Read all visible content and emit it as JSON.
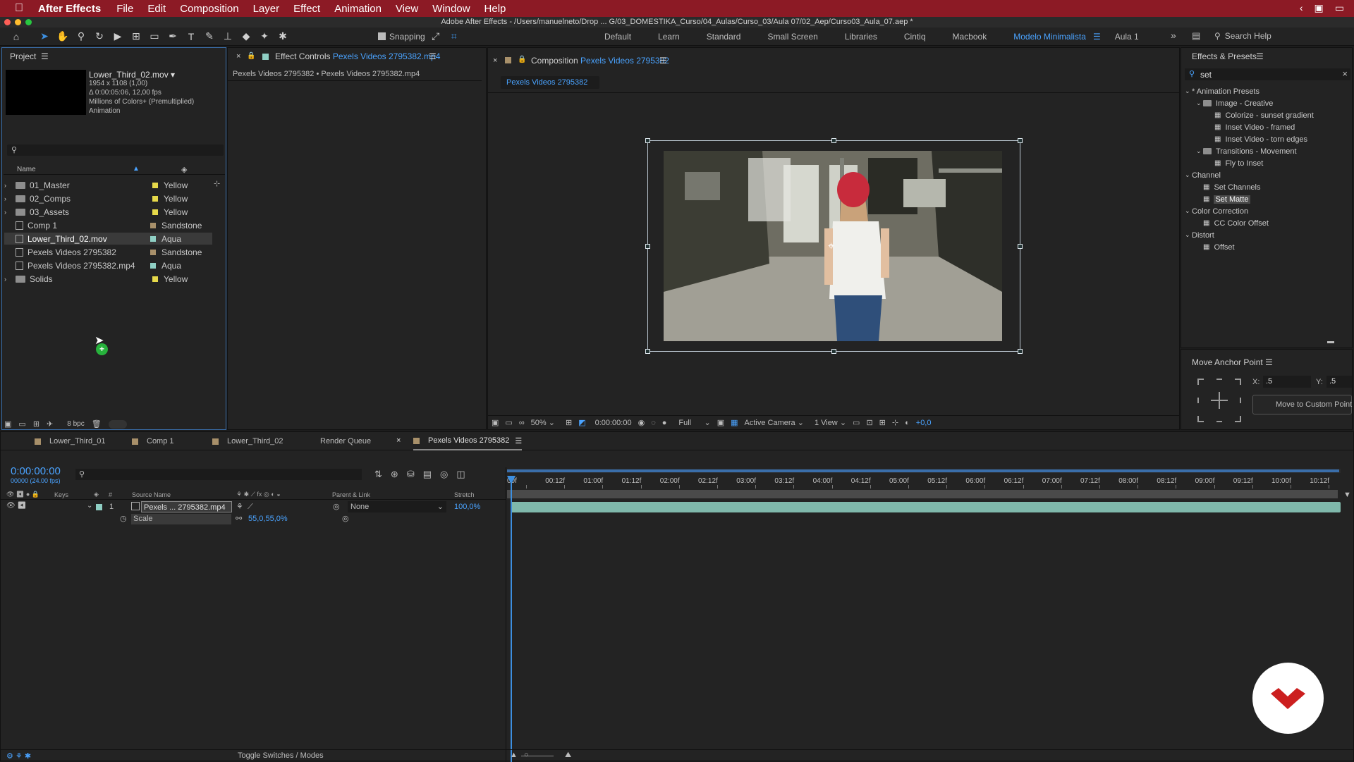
{
  "menubar": {
    "app_name": "After Effects",
    "items": [
      "File",
      "Edit",
      "Composition",
      "Layer",
      "Effect",
      "Animation",
      "View",
      "Window",
      "Help"
    ]
  },
  "window_title": "Adobe After Effects - /Users/manuelneto/Drop ... G/03_DOMESTIKA_Curso/04_Aulas/Curso_03/Aula 07/02_Aep/Curso03_Aula_07.aep *",
  "toolbar": {
    "snapping_label": "Snapping",
    "workspaces": [
      "Default",
      "Learn",
      "Standard",
      "Small Screen",
      "Libraries",
      "Cintiq",
      "Macbook",
      "Modelo Minimalista",
      "Aula 1"
    ],
    "active_workspace": "Modelo Minimalista",
    "search_help": "Search Help"
  },
  "project": {
    "tab_label": "Project",
    "selected_name": "Lower_Third_02.mov ▾",
    "info_lines": [
      "1954 x 1108 (1,00)",
      "Δ 0:00:05:06, 12,00 fps",
      "Millions of Colors+ (Premultiplied)",
      "Animation"
    ],
    "col_name": "Name",
    "items": [
      {
        "name": "01_Master",
        "label": "Yellow",
        "color": "#e6d94a",
        "kind": "folder"
      },
      {
        "name": "02_Comps",
        "label": "Yellow",
        "color": "#e6d94a",
        "kind": "folder"
      },
      {
        "name": "03_Assets",
        "label": "Yellow",
        "color": "#e6d94a",
        "kind": "folder"
      },
      {
        "name": "Comp 1",
        "label": "Sandstone",
        "color": "#a8906a",
        "kind": "comp"
      },
      {
        "name": "Lower_Third_02.mov",
        "label": "Aqua",
        "color": "#8fcfc4",
        "kind": "file"
      },
      {
        "name": "Pexels Videos 2795382",
        "label": "Sandstone",
        "color": "#a8906a",
        "kind": "comp"
      },
      {
        "name": "Pexels Videos 2795382.mp4",
        "label": "Aqua",
        "color": "#8fcfc4",
        "kind": "file"
      },
      {
        "name": "Solids",
        "label": "Yellow",
        "color": "#e6d94a",
        "kind": "folder"
      }
    ],
    "bpc": "8 bpc"
  },
  "effect_controls": {
    "tab_prefix": "Effect Controls",
    "tab_target": "Pexels Videos 2795382.mp4",
    "subtitle": "Pexels Videos 2795382 • Pexels Videos 2795382.mp4"
  },
  "composition": {
    "tab_prefix": "Composition",
    "tab_target": "Pexels Videos 2795382",
    "sub_tab": "Pexels Videos 2795382",
    "zoom": "50%",
    "timecode": "0:00:00:00",
    "resolution": "Full",
    "camera": "Active Camera",
    "view": "1 View",
    "exposure": "+0,0"
  },
  "effects_presets": {
    "tab_label": "Effects & Presets",
    "search_value": "set",
    "tree": [
      {
        "text": "* Animation Presets",
        "level": 0,
        "type": "group"
      },
      {
        "text": "Image - Creative",
        "level": 1,
        "type": "folder"
      },
      {
        "text": "Colorize - sunset gradient",
        "level": 2,
        "type": "item"
      },
      {
        "text": "Inset Video - framed",
        "level": 2,
        "type": "item"
      },
      {
        "text": "Inset Video - torn edges",
        "level": 2,
        "type": "item"
      },
      {
        "text": "Transitions - Movement",
        "level": 1,
        "type": "folder"
      },
      {
        "text": "Fly to Inset",
        "level": 2,
        "type": "item"
      },
      {
        "text": "Channel",
        "level": 0,
        "type": "group"
      },
      {
        "text": "Set Channels",
        "level": 1,
        "type": "item"
      },
      {
        "text": "Set Matte",
        "level": 1,
        "type": "item",
        "selected": true
      },
      {
        "text": "Color Correction",
        "level": 0,
        "type": "group"
      },
      {
        "text": "CC Color Offset",
        "level": 1,
        "type": "item"
      },
      {
        "text": "Distort",
        "level": 0,
        "type": "group"
      },
      {
        "text": "Offset",
        "level": 1,
        "type": "item"
      }
    ]
  },
  "anchor": {
    "tab_label": "Move Anchor Point",
    "x_label": "X:",
    "x_value": ".5",
    "y_label": "Y:",
    "y_value": ".5",
    "custom_btn": "Move to Custom Point"
  },
  "timeline": {
    "tabs": [
      "Lower_Third_01",
      "Comp 1",
      "Lower_Third_02",
      "Render Queue",
      "Pexels Videos 2795382"
    ],
    "active_tab": "Pexels Videos 2795382",
    "timecode": "0:00:00:00",
    "fps": "00000 (24.00 fps)",
    "columns": {
      "keys": "Keys",
      "num": "#",
      "source": "Source Name",
      "parent": "Parent & Link",
      "stretch": "Stretch"
    },
    "layer": {
      "index": "1",
      "name": "Pexels ... 2795382.mp4",
      "parent": "None",
      "stretch": "100,0%"
    },
    "property": {
      "name": "Scale",
      "value": "55,0,55,0%"
    },
    "ruler": [
      "00f",
      "00:12f",
      "01:00f",
      "01:12f",
      "02:00f",
      "02:12f",
      "03:00f",
      "03:12f",
      "04:00f",
      "04:12f",
      "05:00f",
      "05:12f",
      "06:00f",
      "06:12f",
      "07:00f",
      "07:12f",
      "08:00f",
      "08:12f",
      "09:00f",
      "09:12f",
      "10:00f",
      "10:12f"
    ],
    "toggle_label": "Toggle Switches / Modes"
  },
  "colors": {
    "menubar": "#8c1a25",
    "accent": "#4aa3ff",
    "clip_bar": "#7fb8ab",
    "logo": "#cc1f1f"
  }
}
